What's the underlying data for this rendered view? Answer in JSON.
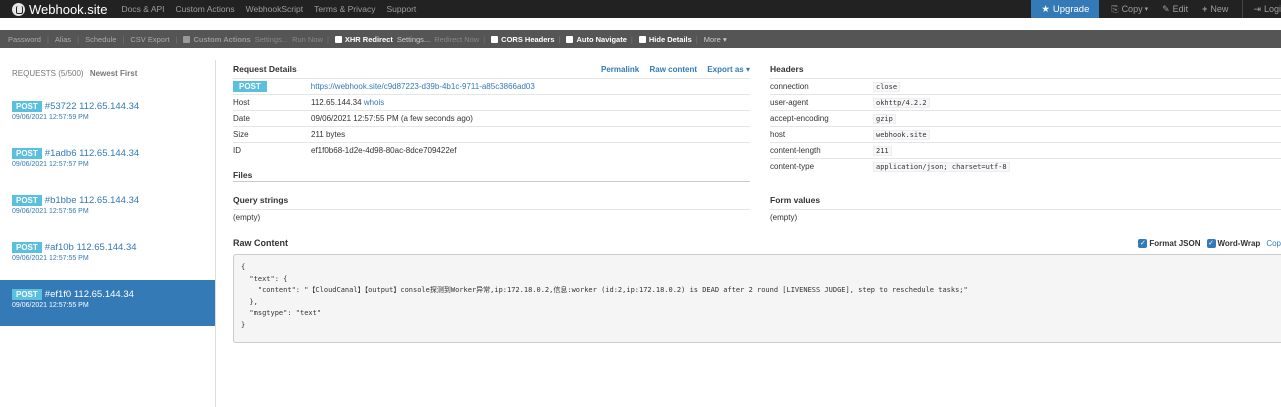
{
  "navbar": {
    "brand": "Webhook.site",
    "links": [
      "Docs & API",
      "Custom Actions",
      "WebhookScript",
      "Terms & Privacy",
      "Support"
    ],
    "upgrade_label": "Upgrade",
    "copy_label": "Copy",
    "edit_label": "Edit",
    "new_label": "New",
    "login_label": "Logi"
  },
  "toolbar": {
    "password": "Password",
    "alias": "Alias",
    "schedule": "Schedule",
    "csv_export": "CSV Export",
    "custom_actions": "Custom Actions",
    "ca_settings": "Settings...",
    "ca_run_now": "Run Now",
    "xhr_redirect": "XHR Redirect",
    "xhr_settings": "Settings...",
    "redirect_now": "Redirect Now",
    "cors_headers": "CORS Headers",
    "auto_navigate": "Auto Navigate",
    "hide_details": "Hide Details",
    "more": "More"
  },
  "sidebar": {
    "title": "REQUESTS (5/500)",
    "sort": "Newest First",
    "requests": [
      {
        "method": "POST",
        "id": "#53722",
        "ip": "112.65.144.34",
        "date": "09/06/2021 12:57:59 PM"
      },
      {
        "method": "POST",
        "id": "#1adb6",
        "ip": "112.65.144.34",
        "date": "09/06/2021 12:57:57 PM"
      },
      {
        "method": "POST",
        "id": "#b1bbe",
        "ip": "112.65.144.34",
        "date": "09/06/2021 12:57:56 PM"
      },
      {
        "method": "POST",
        "id": "#af10b",
        "ip": "112.65.144.34",
        "date": "09/06/2021 12:57:55 PM"
      },
      {
        "method": "POST",
        "id": "#ef1f0",
        "ip": "112.65.144.34",
        "date": "09/06/2021 12:57:55 PM"
      }
    ]
  },
  "details": {
    "title": "Request Details",
    "permalink": "Permalink",
    "raw_content": "Raw content",
    "export_as": "Export as",
    "method": "POST",
    "url": "https://webhook.site/c9d87223-d39b-4b1c-9711-a85c3866ad03",
    "host_label": "Host",
    "host_value": "112.65.144.34",
    "whois": "whois",
    "date_label": "Date",
    "date_value": "09/06/2021 12:57:55 PM (a few seconds ago)",
    "size_label": "Size",
    "size_value": "211 bytes",
    "id_label": "ID",
    "id_value": "ef1f0b68-1d2e-4d98-80ac-8dce709422ef"
  },
  "headers": {
    "title": "Headers",
    "items": [
      {
        "key": "connection",
        "value": "close"
      },
      {
        "key": "user-agent",
        "value": "okhttp/4.2.2"
      },
      {
        "key": "accept-encoding",
        "value": "gzip"
      },
      {
        "key": "host",
        "value": "webhook.site"
      },
      {
        "key": "content-length",
        "value": "211"
      },
      {
        "key": "content-type",
        "value": "application/json; charset=utf-8"
      }
    ]
  },
  "files": {
    "title": "Files"
  },
  "query": {
    "title": "Query strings",
    "value": "(empty)"
  },
  "form": {
    "title": "Form values",
    "value": "(empty)"
  },
  "raw": {
    "title": "Raw Content",
    "format_json": "Format JSON",
    "word_wrap": "Word-Wrap",
    "copy": "Cop",
    "content": "{\n  \"text\": {\n    \"content\": \"【CloudCanal】【output】console探测到Worker异常,ip:172.18.0.2,信息:worker (id:2,ip:172.18.0.2) is DEAD after 2 round [LIVENESS JUDGE], step to reschedule tasks;\"\n  },\n  \"msgtype\": \"text\"\n}"
  }
}
